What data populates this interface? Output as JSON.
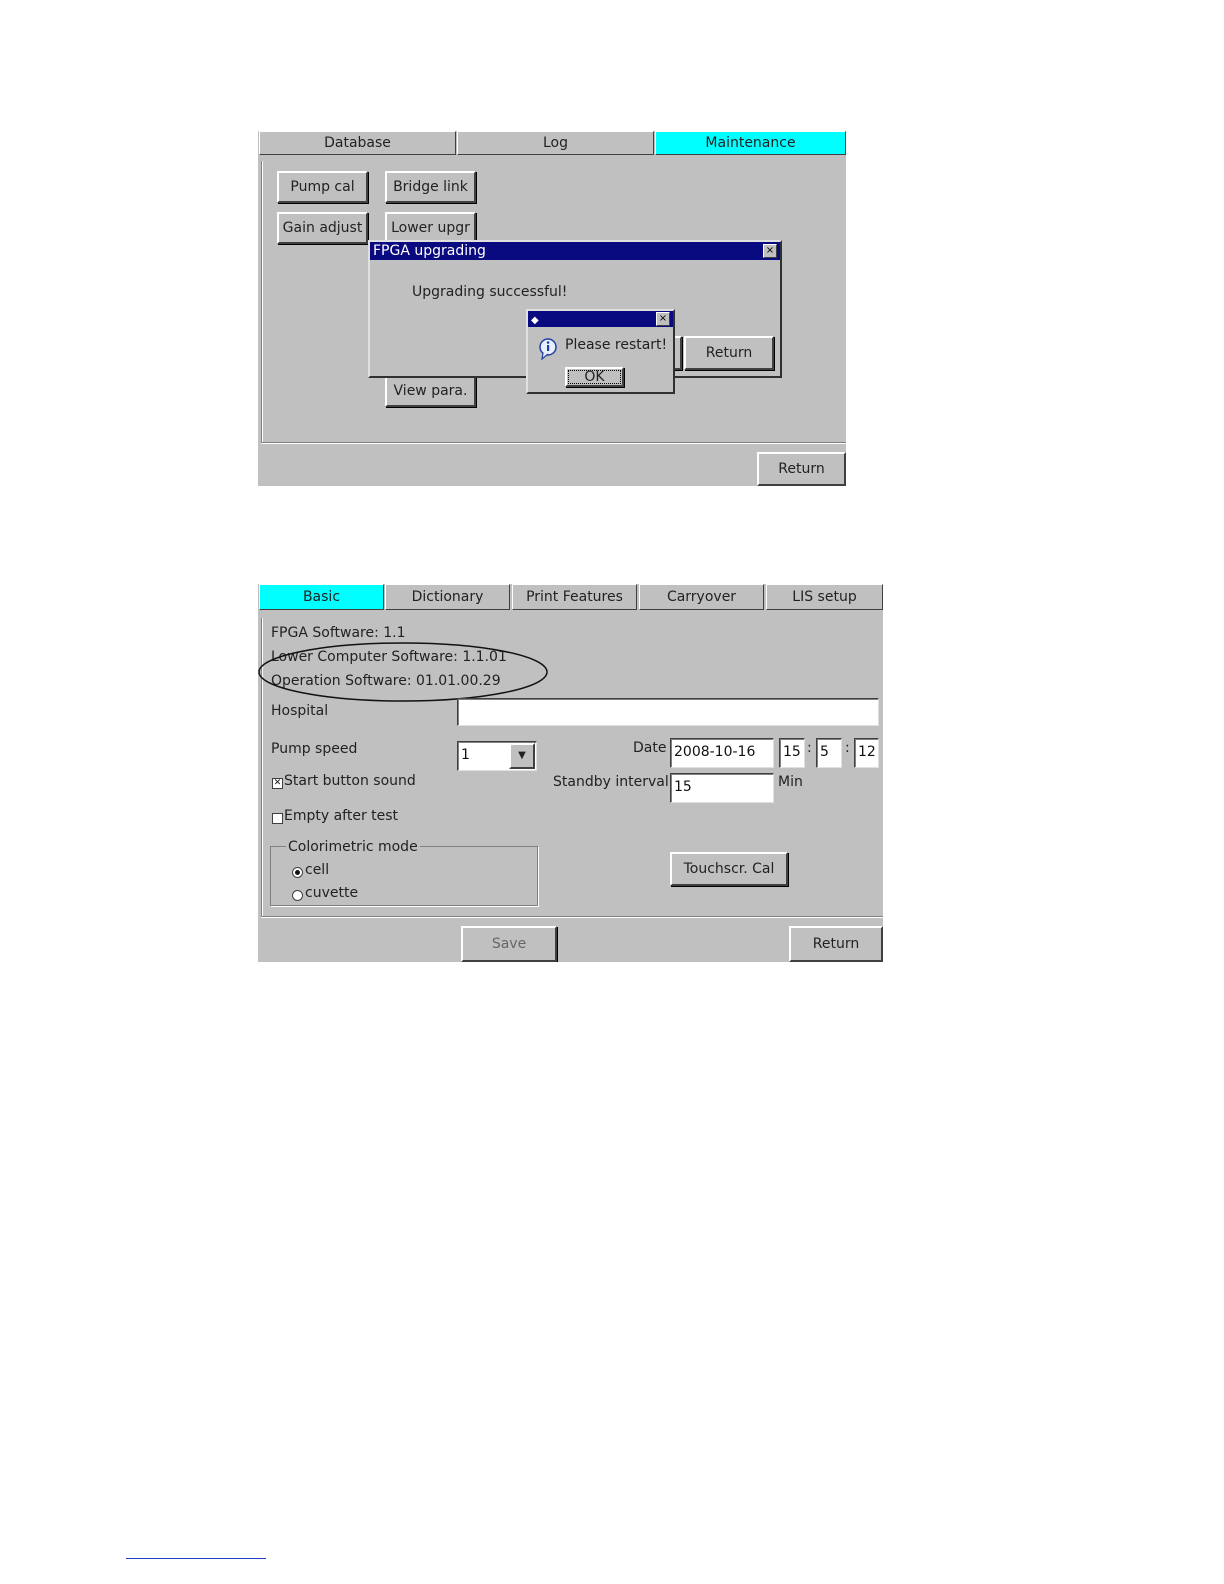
{
  "screen1": {
    "tabs": [
      "Database",
      "Log",
      "Maintenance"
    ],
    "buttons": {
      "pump_cal": "Pump cal",
      "bridge_link": "Bridge link",
      "gain_adjust": "Gain adjust",
      "lower_upgr": "Lower upgr",
      "view_para": "View para.",
      "return": "Return"
    },
    "fpga_dialog": {
      "title": "FPGA upgrading",
      "message": "Upgrading successful!",
      "return_label": "Return",
      "close_glyph": "×"
    },
    "restart_dialog": {
      "message": "Please restart!",
      "ok_label": "OK",
      "close_glyph": "×",
      "icon": "info-icon"
    }
  },
  "screen2": {
    "tabs": [
      "Basic",
      "Dictionary",
      "Print Features",
      "Carryover",
      "LIS setup"
    ],
    "fpga_software": "FPGA Software: 1.1",
    "lower_software": "Lower Computer Software: 1.1.01",
    "operation_software": "Operation Software: 01.01.00.29",
    "hospital_label": "Hospital",
    "hospital_value": "",
    "pump_speed_label": "Pump speed",
    "pump_speed_value": "1",
    "date_label": "Date",
    "date_value": "2008-10-16",
    "time_hour": "15",
    "time_min": "5",
    "time_sec": "12",
    "time_sep": ":",
    "start_sound_label": "Start button sound",
    "start_sound_checked": true,
    "standby_label": "Standby interval",
    "standby_value": "15",
    "standby_unit": "Min",
    "empty_after_test_label": "Empty after test",
    "empty_after_test_checked": false,
    "colorimetric_legend": "Colorimetric mode",
    "mode_cell": "cell",
    "mode_cuvette": "cuvette",
    "mode_selected": "cell",
    "touchscr_cal": "Touchscr. Cal",
    "save_label": "Save",
    "return_label": "Return"
  },
  "colors": {
    "active_tab": "#00ffff",
    "panel": "#c0c0c0",
    "titlebar": "#0a0a80"
  }
}
